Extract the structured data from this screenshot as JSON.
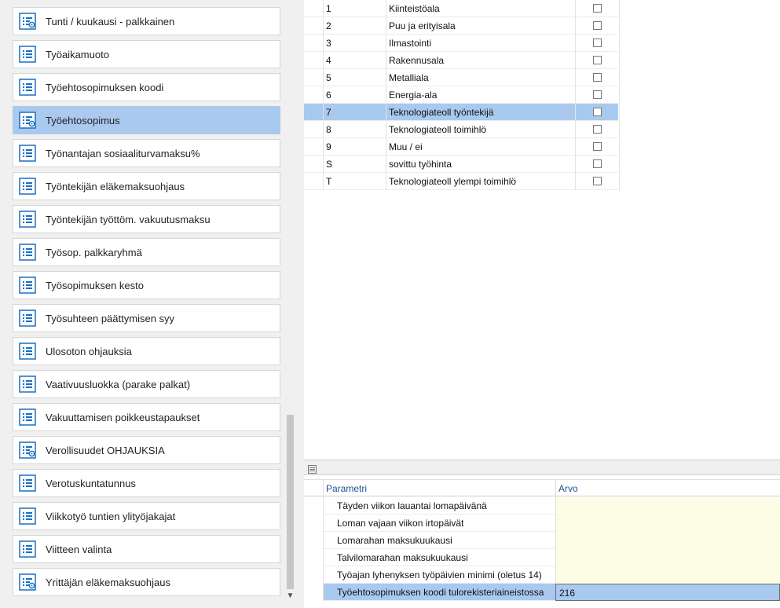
{
  "left_list": {
    "items": [
      {
        "label": "Tunti / kuukausi - palkkainen",
        "icon": "list-settings-icon",
        "selected": false
      },
      {
        "label": "Työaikamuoto",
        "icon": "list-icon",
        "selected": false
      },
      {
        "label": "Työehtosopimuksen koodi",
        "icon": "list-icon",
        "selected": false
      },
      {
        "label": "Työehtosopimus",
        "icon": "list-settings-icon",
        "selected": true
      },
      {
        "label": "Työnantajan sosiaaliturvamaksu%",
        "icon": "list-icon",
        "selected": false
      },
      {
        "label": "Työntekijän eläkemaksuohjaus",
        "icon": "list-icon",
        "selected": false
      },
      {
        "label": "Työntekijän työttöm. vakuutusmaksu",
        "icon": "list-icon",
        "selected": false
      },
      {
        "label": "Työsop. palkkaryhmä",
        "icon": "list-icon",
        "selected": false
      },
      {
        "label": "Työsopimuksen kesto",
        "icon": "list-icon",
        "selected": false
      },
      {
        "label": "Työsuhteen päättymisen syy",
        "icon": "list-icon",
        "selected": false
      },
      {
        "label": "Ulosoton ohjauksia",
        "icon": "list-icon",
        "selected": false
      },
      {
        "label": "Vaativuusluokka (parake palkat)",
        "icon": "list-icon",
        "selected": false
      },
      {
        "label": "Vakuuttamisen poikkeustapaukset",
        "icon": "list-icon",
        "selected": false
      },
      {
        "label": "Verollisuudet OHJAUKSIA",
        "icon": "list-settings-icon",
        "selected": false
      },
      {
        "label": "Verotuskuntatunnus",
        "icon": "list-icon",
        "selected": false
      },
      {
        "label": "Viikkotyö tuntien ylityöjakajat",
        "icon": "list-icon",
        "selected": false
      },
      {
        "label": "Viitteen valinta",
        "icon": "list-icon",
        "selected": false
      },
      {
        "label": "Yrittäjän eläkemaksuohjaus",
        "icon": "list-settings-icon",
        "selected": false
      }
    ]
  },
  "top_grid": {
    "rows": [
      {
        "code": "1",
        "name": "Kiinteistöala",
        "checked": false,
        "selected": false
      },
      {
        "code": "2",
        "name": "Puu ja erityisala",
        "checked": false,
        "selected": false
      },
      {
        "code": "3",
        "name": "Ilmastointi",
        "checked": false,
        "selected": false
      },
      {
        "code": "4",
        "name": "Rakennusala",
        "checked": false,
        "selected": false
      },
      {
        "code": "5",
        "name": "Metalliala",
        "checked": false,
        "selected": false
      },
      {
        "code": "6",
        "name": "Energia-ala",
        "checked": false,
        "selected": false
      },
      {
        "code": "7",
        "name": "Teknologiateoll työntekijä",
        "checked": false,
        "selected": true
      },
      {
        "code": "8",
        "name": "Teknologiateoll toimihlö",
        "checked": false,
        "selected": false
      },
      {
        "code": "9",
        "name": "Muu / ei",
        "checked": false,
        "selected": false
      },
      {
        "code": "S",
        "name": "sovittu työhinta",
        "checked": false,
        "selected": false
      },
      {
        "code": "T",
        "name": "Teknologiateoll ylempi toimihlö",
        "checked": false,
        "selected": false
      }
    ]
  },
  "param_grid": {
    "headers": {
      "param": "Parametri",
      "value": "Arvo"
    },
    "rows": [
      {
        "param": "Täyden viikon lauantai lomapäivänä",
        "value": "",
        "selected": false
      },
      {
        "param": "Loman vajaan viikon irtopäivät",
        "value": "",
        "selected": false
      },
      {
        "param": "Lomarahan maksukuukausi",
        "value": "",
        "selected": false
      },
      {
        "param": "Talvilomarahan maksukuukausi",
        "value": "",
        "selected": false
      },
      {
        "param": "Työajan lyhenyksen työpäivien minimi (oletus 14)",
        "value": "",
        "selected": false
      },
      {
        "param": "Työehtosopimuksen koodi tulorekisteriaineistossa",
        "value": "216",
        "selected": true
      }
    ]
  },
  "colors": {
    "accent_selected": "#a9c9ef",
    "icon_blue": "#1b6fc2",
    "header_text": "#1f4f9a",
    "value_cell": "#fdfde6"
  }
}
